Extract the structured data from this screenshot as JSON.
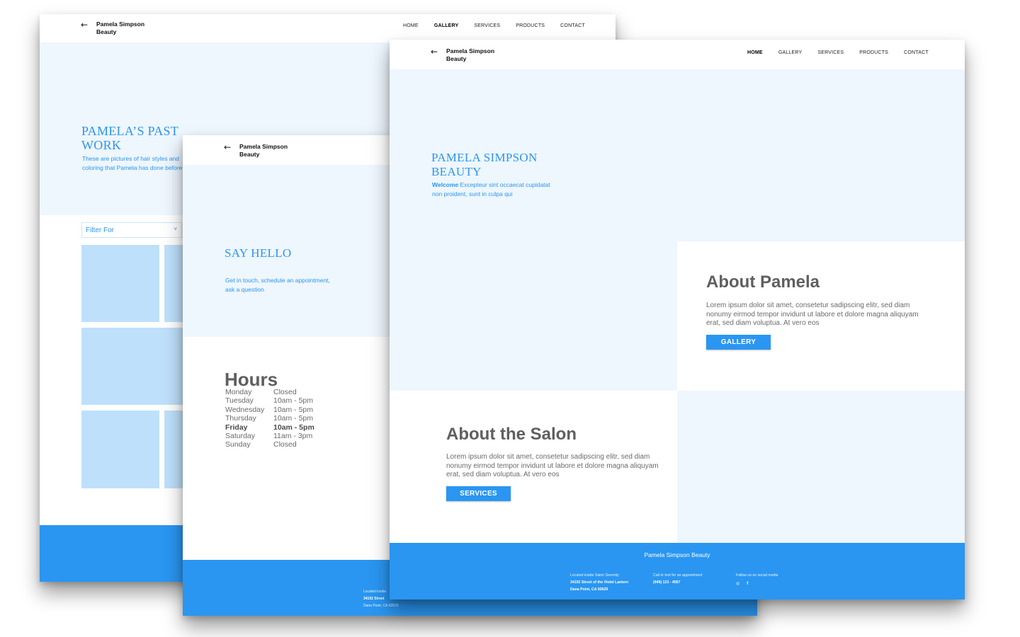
{
  "brand": {
    "line1": "Pamela Simpson",
    "line2": "Beauty",
    "back_icon": "arrow-left-icon"
  },
  "nav_gallery": [
    "HOME",
    "GALLERY",
    "SERVICES",
    "PRODUCTS",
    "CONTACT"
  ],
  "nav_home": [
    "HOME",
    "GALLERY",
    "SERVICES",
    "PRODUCTS",
    "CONTACT"
  ],
  "gallery": {
    "title": "PAMELA’S PAST WORK",
    "subtitle": "These are pictures of hair styles and coloring that Pamela has done before",
    "filter_placeholder": "Filter For",
    "filter_chevron": "˅"
  },
  "contact": {
    "title": "SAY HELLO",
    "subtitle": "Get in touch, schedule an appointment, ask a question",
    "hours_title": "Hours",
    "hours": [
      {
        "day": "Monday",
        "time": "Closed"
      },
      {
        "day": "Tuesday",
        "time": "10am - 5pm"
      },
      {
        "day": "Wednesday",
        "time": "10am - 5pm"
      },
      {
        "day": "Thursday",
        "time": "10am - 5pm"
      },
      {
        "day": "Friday",
        "time": "10am - 5pm"
      },
      {
        "day": "Saturday",
        "time": "11am - 3pm"
      },
      {
        "day": "Sunday",
        "time": "Closed"
      }
    ],
    "footer_line1": "Located inside",
    "footer_line2": "34192 Street",
    "footer_line3": "Dana Point, CA 92629"
  },
  "home": {
    "title": "PAMELA SIMPSON BEAUTY",
    "welcome": "Welcome",
    "subtitle_rest": " Excepteur sint occaecat cupidatat non proident, sunt in culpa qui",
    "about_pamela_title": "About Pamela",
    "about_pamela_text": "Lorem ipsum dolor sit amet, consetetur sadipscing elitr, sed diam nonumy eirmod tempor invidunt ut labore et dolore magna aliquyam erat, sed diam voluptua. At vero eos",
    "gallery_button": "GALLERY",
    "about_salon_title": "About the Salon",
    "about_salon_text": "Lorem ipsum dolor sit amet, consetetur sadipscing elitr, sed diam nonumy eirmod tempor invidunt ut labore et dolore magna aliquyam erat, sed diam voluptua. At vero eos",
    "services_button": "SERVICES",
    "footer": {
      "title": "Pamela Simpson Beauty",
      "col1_label": "Located inside Salon Serenity",
      "col1_line1": "34192 Street of the Violet Lantern",
      "col1_line2": "Dana Point, CA 92629",
      "col2_label": "Call or text for an appointment",
      "col2_line1": "(949) 123 - 4567",
      "col3_label": "Follow us on social media",
      "instagram_icon": "instagram-icon",
      "facebook_icon": "facebook-icon"
    }
  },
  "colors": {
    "accent": "#2a96f1",
    "light_bg": "#eef6fe",
    "tile": "#bfe0fb",
    "text_gray": "#5f5f5f"
  }
}
